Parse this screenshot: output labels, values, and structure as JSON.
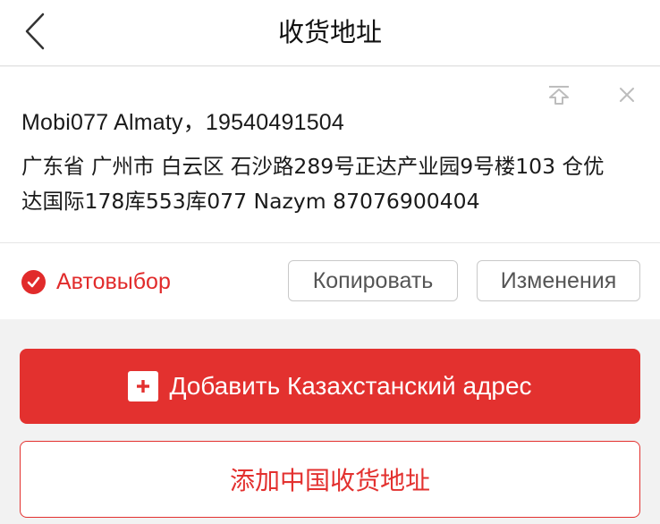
{
  "header": {
    "title": "收货地址",
    "back_icon": "chevron-left-icon"
  },
  "address_card": {
    "name_line": "Mobi077 Almaty，19540491504",
    "detail": "广东省 广州市 白云区 石沙路289号正达产业园9号楼103 仓优达国际178库553库077 Nazym 87076900404",
    "icons": [
      "pin-to-top-icon",
      "close-icon"
    ],
    "default_label": "Автовыбор",
    "default_checked": true,
    "copy_label": "Копировать",
    "edit_label": "Изменения"
  },
  "actions": {
    "add_kz_label": "Добавить Казахстанский адрес",
    "add_cn_label": "添加中国收货地址"
  },
  "colors": {
    "accent": "#e3312f",
    "background": "#f2f2f2",
    "card": "#ffffff"
  }
}
